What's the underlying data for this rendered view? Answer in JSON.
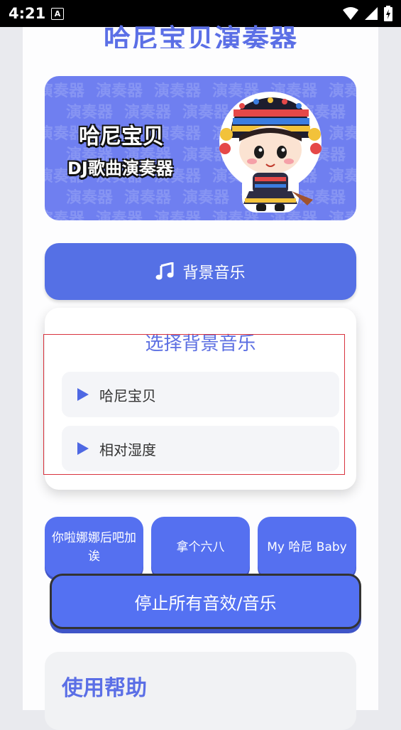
{
  "status_bar": {
    "time": "4:21",
    "indicator": "A",
    "icons": [
      "wifi-icon",
      "signal-icon",
      "battery-icon"
    ]
  },
  "app": {
    "title": "哈尼宝贝演奏器"
  },
  "banner": {
    "title": "哈尼宝贝",
    "subtitle": "DJ歌曲演奏器",
    "pattern_text": "演奏器"
  },
  "bgm_button": {
    "label": "背景音乐",
    "icon": "music-note-icon"
  },
  "music_panel": {
    "title": "选择背景音乐",
    "items": [
      {
        "label": "哈尼宝贝"
      },
      {
        "label": "相对湿度"
      }
    ]
  },
  "sfx_buttons": [
    {
      "label": "你啦娜娜后吧加诶"
    },
    {
      "label": "拿个六八"
    },
    {
      "label": "My 哈尼 Baby"
    }
  ],
  "stop_button": {
    "label": "停止所有音效/音乐"
  },
  "help": {
    "title": "使用帮助"
  },
  "colors": {
    "accent": "#5570e5",
    "panel_title": "#5c6fe2",
    "highlight": "#d9343f"
  }
}
